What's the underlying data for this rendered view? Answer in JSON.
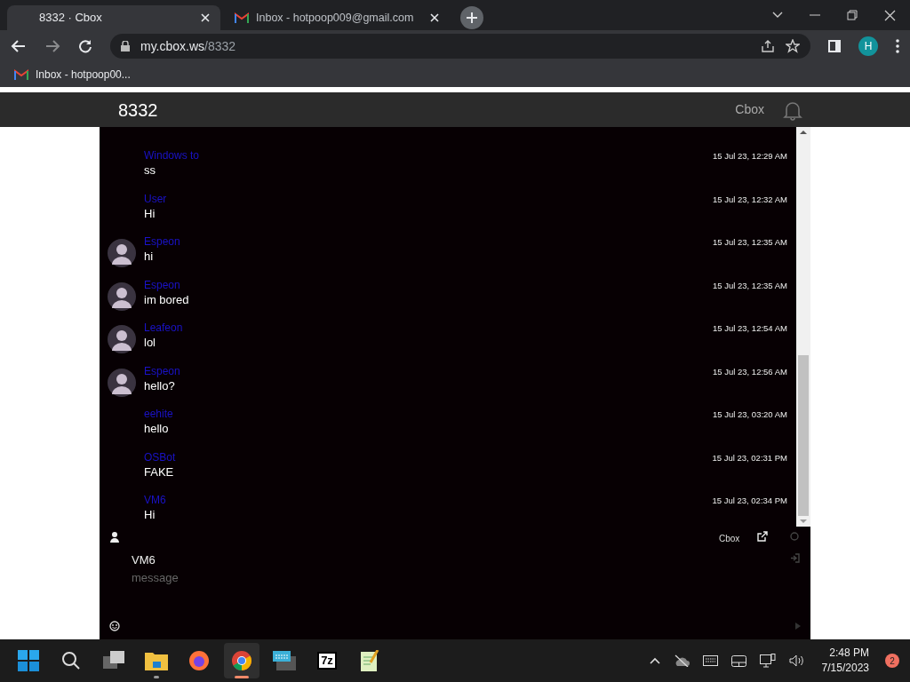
{
  "browser": {
    "tabs": [
      {
        "title": "8332 · Cbox",
        "selected": true,
        "kind": "page"
      },
      {
        "title": "Inbox - hotpoop009@gmail.com",
        "selected": false,
        "kind": "mail"
      }
    ],
    "address": {
      "host": "my.cbox.ws",
      "path": "/8332"
    },
    "bookmarks": [
      {
        "label": "Inbox - hotpoop00..."
      }
    ],
    "profile_letter": "H"
  },
  "page": {
    "title": "8332",
    "brand_link": "Cbox"
  },
  "messages": [
    {
      "user": "Windows to",
      "text": "ss",
      "time": "15 Jul 23, 12:29 AM",
      "avatar": false
    },
    {
      "user": "User",
      "text": "Hi",
      "time": "15 Jul 23, 12:32 AM",
      "avatar": false
    },
    {
      "user": "Espeon",
      "text": "hi",
      "time": "15 Jul 23, 12:35 AM",
      "avatar": true
    },
    {
      "user": "Espeon",
      "text": "im bored",
      "time": "15 Jul 23, 12:35 AM",
      "avatar": true
    },
    {
      "user": "Leafeon",
      "text": "lol",
      "time": "15 Jul 23, 12:54 AM",
      "avatar": true
    },
    {
      "user": "Espeon",
      "text": "hello?",
      "time": "15 Jul 23, 12:56 AM",
      "avatar": true
    },
    {
      "user": "eehite",
      "text": "hello",
      "time": "15 Jul 23, 03:20 AM",
      "avatar": false
    },
    {
      "user": "OSBot",
      "text": "FAKE",
      "time": "15 Jul 23, 02:31 PM",
      "avatar": false
    },
    {
      "user": "VM6",
      "text": "Hi",
      "time": "15 Jul 23, 02:34 PM",
      "avatar": false
    }
  ],
  "composer": {
    "name": "VM6",
    "placeholder": "message",
    "brand": "Cbox"
  },
  "taskbar": {
    "apps": [
      {
        "kind": "start",
        "selected": false,
        "running": false
      },
      {
        "kind": "search",
        "selected": false,
        "running": false
      },
      {
        "kind": "taskview",
        "selected": false,
        "running": false
      },
      {
        "kind": "folder",
        "selected": false,
        "running": true
      },
      {
        "kind": "firefox",
        "selected": false,
        "running": false
      },
      {
        "kind": "chrome",
        "selected": true,
        "running": true
      },
      {
        "kind": "keyboard",
        "selected": false,
        "running": false
      },
      {
        "kind": "archiver",
        "selected": false,
        "running": false,
        "label": "7z"
      },
      {
        "kind": "notepad",
        "selected": false,
        "running": false
      }
    ],
    "time": "2:48 PM",
    "date": "7/15/2023",
    "badge": "2"
  }
}
